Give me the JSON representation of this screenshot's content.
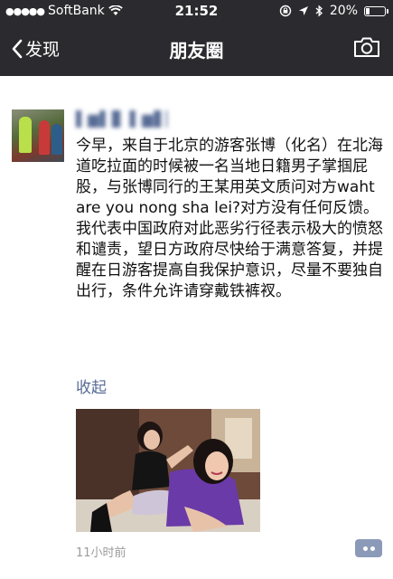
{
  "status_bar": {
    "signal_dots": "●●●●●",
    "carrier": "SoftBank",
    "time": "21:52",
    "battery_percent": "20%",
    "battery_level": 0.2
  },
  "nav": {
    "back_label": "发现",
    "title": "朋友圈"
  },
  "moment": {
    "username": "▌▆▌▊ ▌▆▋▏",
    "text": "今早，来自于北京的游客张博（化名）在北海道吃拉面的时候被一名当地日籍男子掌掴屁股，与张博同行的王某用英文质问对方waht are you nong sha lei?对方没有任何反馈。我代表中国政府对此恶劣行径表示极大的愤怒和谴责，望日方政府尽快给于满意答复，并提醒在日游客提高自我保护意识，尽量不要独自出行，条件允许请穿戴铁裤衩。",
    "collapse_label": "收起",
    "timestamp": "11小时前"
  },
  "colors": {
    "bar_bg": "#2b2b2f",
    "link_blue": "#576b95",
    "comment_btn": "#8b9ab8",
    "timestamp_gray": "#9b9b9b"
  }
}
